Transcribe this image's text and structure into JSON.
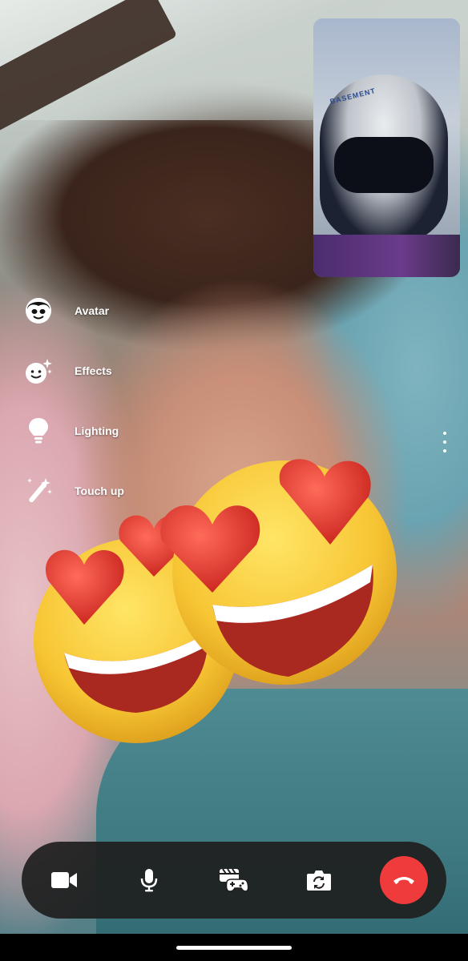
{
  "effects_menu": {
    "items": [
      {
        "label": "Avatar",
        "icon": "avatar-icon"
      },
      {
        "label": "Effects",
        "icon": "sparkle-face-icon"
      },
      {
        "label": "Lighting",
        "icon": "lightbulb-icon"
      },
      {
        "label": "Touch up",
        "icon": "magic-wand-icon"
      }
    ]
  },
  "self_preview": {
    "helmet_text": "BASEMENT"
  },
  "controls": {
    "buttons": [
      {
        "name": "video-toggle",
        "icon": "video-camera-icon"
      },
      {
        "name": "mute-toggle",
        "icon": "microphone-icon"
      },
      {
        "name": "games",
        "icon": "game-controller-icon"
      },
      {
        "name": "flip-camera",
        "icon": "camera-flip-icon"
      },
      {
        "name": "end-call",
        "icon": "hang-up-icon"
      }
    ],
    "end_call_color": "#ef3b3b"
  },
  "stickers": [
    "heart-eyes-emoji",
    "heart-eyes-emoji"
  ]
}
